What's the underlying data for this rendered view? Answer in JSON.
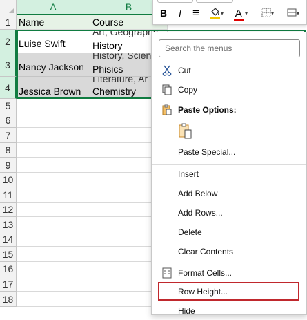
{
  "columns": [
    "A",
    "B"
  ],
  "rows": [
    "1",
    "2",
    "3",
    "4",
    "5",
    "6",
    "7",
    "8",
    "9",
    "10",
    "11",
    "12",
    "13",
    "14",
    "15",
    "16",
    "17",
    "18"
  ],
  "table": {
    "header": {
      "name": "Name",
      "course": "Course"
    },
    "records": [
      {
        "name": "Luise Swift",
        "course": "History",
        "course_overflow": "Art, Geography,"
      },
      {
        "name": "Nancy Jackson",
        "course": "Phisics",
        "course_overflow": "History, Scien"
      },
      {
        "name": "Jessica Brown",
        "course": "Chemistry",
        "course_overflow": "Literature, Ar"
      }
    ]
  },
  "toolbar": {
    "bold": "B",
    "italic": "I",
    "align": "≡",
    "fill_icon": "paint-bucket-icon",
    "font_color": "A",
    "font_color_hex": "#e00000",
    "borders_icon": "borders-icon",
    "format_icon": "format-cells-icon"
  },
  "menu": {
    "search_placeholder": "Search the menus",
    "cut": "Cut",
    "copy": "Copy",
    "paste_options": "Paste Options:",
    "paste_special": "Paste Special...",
    "insert": "Insert",
    "add_below": "Add Below",
    "add_rows": "Add Rows...",
    "delete": "Delete",
    "clear_contents": "Clear Contents",
    "format_cells": "Format Cells...",
    "row_height": "Row Height...",
    "hide": "Hide"
  },
  "colors": {
    "selection_green": "#107c41",
    "highlight_red": "#c0282d",
    "cell_gray": "#d9d9d9"
  }
}
